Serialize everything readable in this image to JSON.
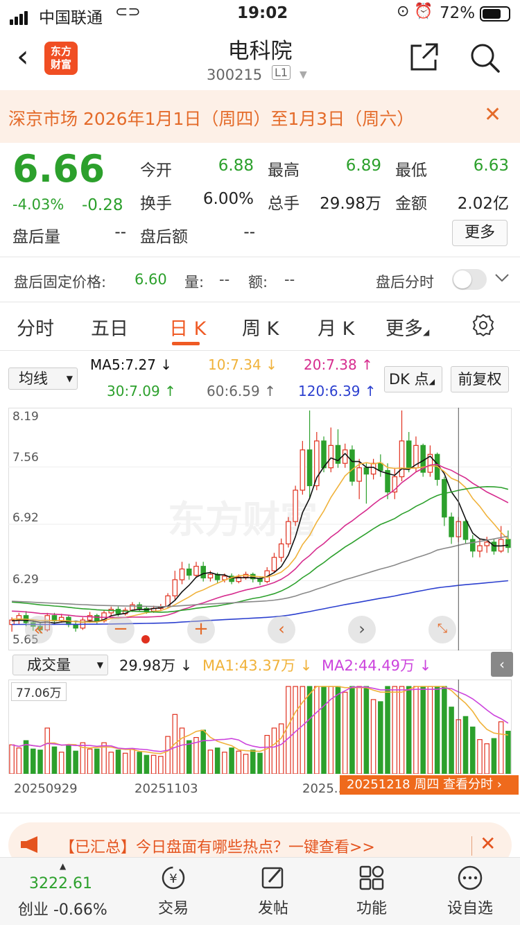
{
  "status_bar": {
    "carrier": "中国联通",
    "time": "19:02",
    "battery": "72%"
  },
  "header": {
    "title": "电科院",
    "code": "300215",
    "badge": "L1",
    "logo_text": [
      "东方",
      "财富"
    ]
  },
  "banner": {
    "text": "深京市场 2026年1月1日（周四）至1月3日（周六）"
  },
  "quote": {
    "price": "6.66",
    "pct": "-4.03%",
    "change": "-0.28",
    "fields": [
      {
        "label": "今开",
        "value": "6.88",
        "color": "green"
      },
      {
        "label": "最高",
        "value": "6.89",
        "color": "green"
      },
      {
        "label": "最低",
        "value": "6.63",
        "color": "green"
      },
      {
        "label": "换手",
        "value": "6.00%",
        "color": "black"
      },
      {
        "label": "总手",
        "value": "29.98万",
        "color": "black"
      },
      {
        "label": "金额",
        "value": "2.02亿",
        "color": "black"
      },
      {
        "label": "盘后量",
        "value": "--",
        "color": "black"
      },
      {
        "label": "盘后额",
        "value": "--",
        "color": "black"
      }
    ],
    "more_button": "更多"
  },
  "after_hours": {
    "fixed_price_label": "盘后固定价格:",
    "fixed_price": "6.60",
    "vol_label": "量:",
    "vol": "--",
    "amt_label": "额:",
    "amt": "--",
    "timeshare_label": "盘后分时"
  },
  "tabs": [
    "分时",
    "五日",
    "日 K",
    "周 K",
    "月 K",
    "更多"
  ],
  "ma_legend": {
    "select": "均线",
    "ma5": "MA5:7.27 ↓",
    "ma10": "10:7.34 ↓",
    "ma20": "20:7.38 ↑",
    "ma30": "30:7.09 ↑",
    "ma60": "60:6.59 ↑",
    "ma120": "120:6.39 ↑",
    "dk_button": "DK 点",
    "restore_button": "前复权"
  },
  "kchart_axis": [
    "8.19",
    "7.56",
    "6.92",
    "6.29",
    "5.65"
  ],
  "watermark": "东方财富",
  "volume": {
    "select": "成交量",
    "value": "29.98万 ↓",
    "ma1": "MA1:43.37万 ↓",
    "ma2": "MA2:44.49万 ↓",
    "axis_top": "77.06万"
  },
  "dates": [
    "20250929",
    "20251103",
    "2025..."
  ],
  "hover_tag": "20251218 周四 查看分时 ›",
  "promo": {
    "text": "【已汇总】今日盘面有哪些热点？一键查看>>"
  },
  "bottom_nav": {
    "index_value": "3222.61",
    "index_name": "创业 -0.66%",
    "items": [
      "交易",
      "发帖",
      "功能",
      "设自选"
    ]
  },
  "colors": {
    "up": "#e0301e",
    "down": "#2ca02c",
    "accent": "#ef5a24"
  },
  "chart_data": {
    "type": "candlestick",
    "ylim": [
      5.65,
      8.19
    ],
    "candles": [
      [
        5.8,
        5.85,
        5.72,
        5.88
      ],
      [
        5.85,
        5.9,
        5.8,
        5.93
      ],
      [
        5.9,
        5.82,
        5.78,
        5.95
      ],
      [
        5.82,
        5.78,
        5.73,
        5.86
      ],
      [
        5.78,
        5.74,
        5.7,
        5.82
      ],
      [
        5.74,
        5.9,
        5.72,
        5.93
      ],
      [
        5.9,
        5.84,
        5.8,
        5.93
      ],
      [
        5.84,
        5.88,
        5.82,
        5.92
      ],
      [
        5.88,
        5.8,
        5.77,
        5.9
      ],
      [
        5.8,
        5.76,
        5.72,
        5.83
      ],
      [
        5.76,
        5.85,
        5.74,
        5.88
      ],
      [
        5.85,
        5.9,
        5.82,
        5.94
      ],
      [
        5.9,
        5.84,
        5.81,
        5.92
      ],
      [
        5.84,
        5.93,
        5.82,
        5.96
      ],
      [
        5.93,
        5.97,
        5.9,
        6.0
      ],
      [
        5.97,
        5.92,
        5.89,
        6.0
      ],
      [
        5.92,
        5.96,
        5.9,
        5.99
      ],
      [
        5.96,
        6.02,
        5.94,
        6.05
      ],
      [
        6.02,
        5.98,
        5.95,
        6.05
      ],
      [
        5.98,
        5.95,
        5.92,
        6.0
      ],
      [
        5.95,
        5.98,
        5.93,
        6.01
      ],
      [
        5.98,
        6.0,
        5.95,
        6.03
      ],
      [
        6.0,
        6.12,
        5.98,
        6.15
      ],
      [
        6.12,
        6.3,
        6.08,
        6.4
      ],
      [
        6.3,
        6.42,
        6.25,
        6.5
      ],
      [
        6.42,
        6.35,
        6.3,
        6.48
      ],
      [
        6.35,
        6.45,
        6.32,
        6.5
      ],
      [
        6.45,
        6.32,
        6.28,
        6.5
      ],
      [
        6.32,
        6.36,
        6.28,
        6.4
      ],
      [
        6.36,
        6.3,
        6.26,
        6.38
      ],
      [
        6.3,
        6.34,
        6.27,
        6.37
      ],
      [
        6.34,
        6.28,
        6.25,
        6.37
      ],
      [
        6.28,
        6.33,
        6.26,
        6.36
      ],
      [
        6.33,
        6.36,
        6.3,
        6.39
      ],
      [
        6.36,
        6.31,
        6.27,
        6.38
      ],
      [
        6.31,
        6.28,
        6.24,
        6.34
      ],
      [
        6.28,
        6.4,
        6.26,
        6.44
      ],
      [
        6.4,
        6.55,
        6.38,
        6.6
      ],
      [
        6.55,
        6.7,
        6.5,
        6.76
      ],
      [
        6.7,
        6.95,
        6.66,
        7.0
      ],
      [
        6.95,
        7.3,
        6.9,
        7.35
      ],
      [
        7.3,
        7.75,
        7.25,
        7.85
      ],
      [
        7.75,
        7.35,
        7.2,
        8.19
      ],
      [
        7.35,
        7.85,
        7.3,
        7.95
      ],
      [
        7.85,
        7.55,
        7.5,
        7.9
      ],
      [
        7.55,
        7.8,
        7.5,
        8.0
      ],
      [
        7.8,
        7.6,
        7.55,
        7.98
      ],
      [
        7.6,
        7.75,
        7.55,
        7.82
      ],
      [
        7.75,
        7.4,
        7.35,
        7.8
      ],
      [
        7.4,
        7.55,
        7.2,
        7.65
      ],
      [
        7.55,
        7.48,
        7.15,
        7.6
      ],
      [
        7.48,
        7.6,
        7.42,
        7.65
      ],
      [
        7.6,
        7.52,
        7.45,
        7.7
      ],
      [
        7.52,
        7.28,
        7.2,
        7.6
      ],
      [
        7.28,
        7.45,
        7.2,
        7.55
      ],
      [
        7.45,
        7.85,
        7.4,
        8.19
      ],
      [
        7.85,
        7.55,
        7.5,
        7.95
      ],
      [
        7.55,
        7.8,
        7.5,
        7.9
      ],
      [
        7.8,
        7.5,
        7.45,
        7.82
      ],
      [
        7.5,
        7.7,
        7.45,
        7.8
      ],
      [
        7.7,
        7.42,
        7.35,
        7.72
      ],
      [
        7.42,
        7.0,
        6.9,
        7.45
      ],
      [
        7.0,
        6.78,
        6.7,
        7.05
      ],
      [
        6.78,
        6.95,
        6.72,
        7.0
      ],
      [
        6.95,
        6.75,
        6.7,
        6.98
      ],
      [
        6.75,
        6.62,
        6.55,
        6.8
      ],
      [
        6.62,
        6.68,
        6.55,
        6.75
      ],
      [
        6.68,
        6.72,
        6.6,
        6.78
      ],
      [
        6.72,
        6.62,
        6.58,
        6.75
      ],
      [
        6.62,
        6.75,
        6.6,
        6.9
      ],
      [
        6.75,
        6.66,
        6.6,
        6.85
      ]
    ]
  }
}
